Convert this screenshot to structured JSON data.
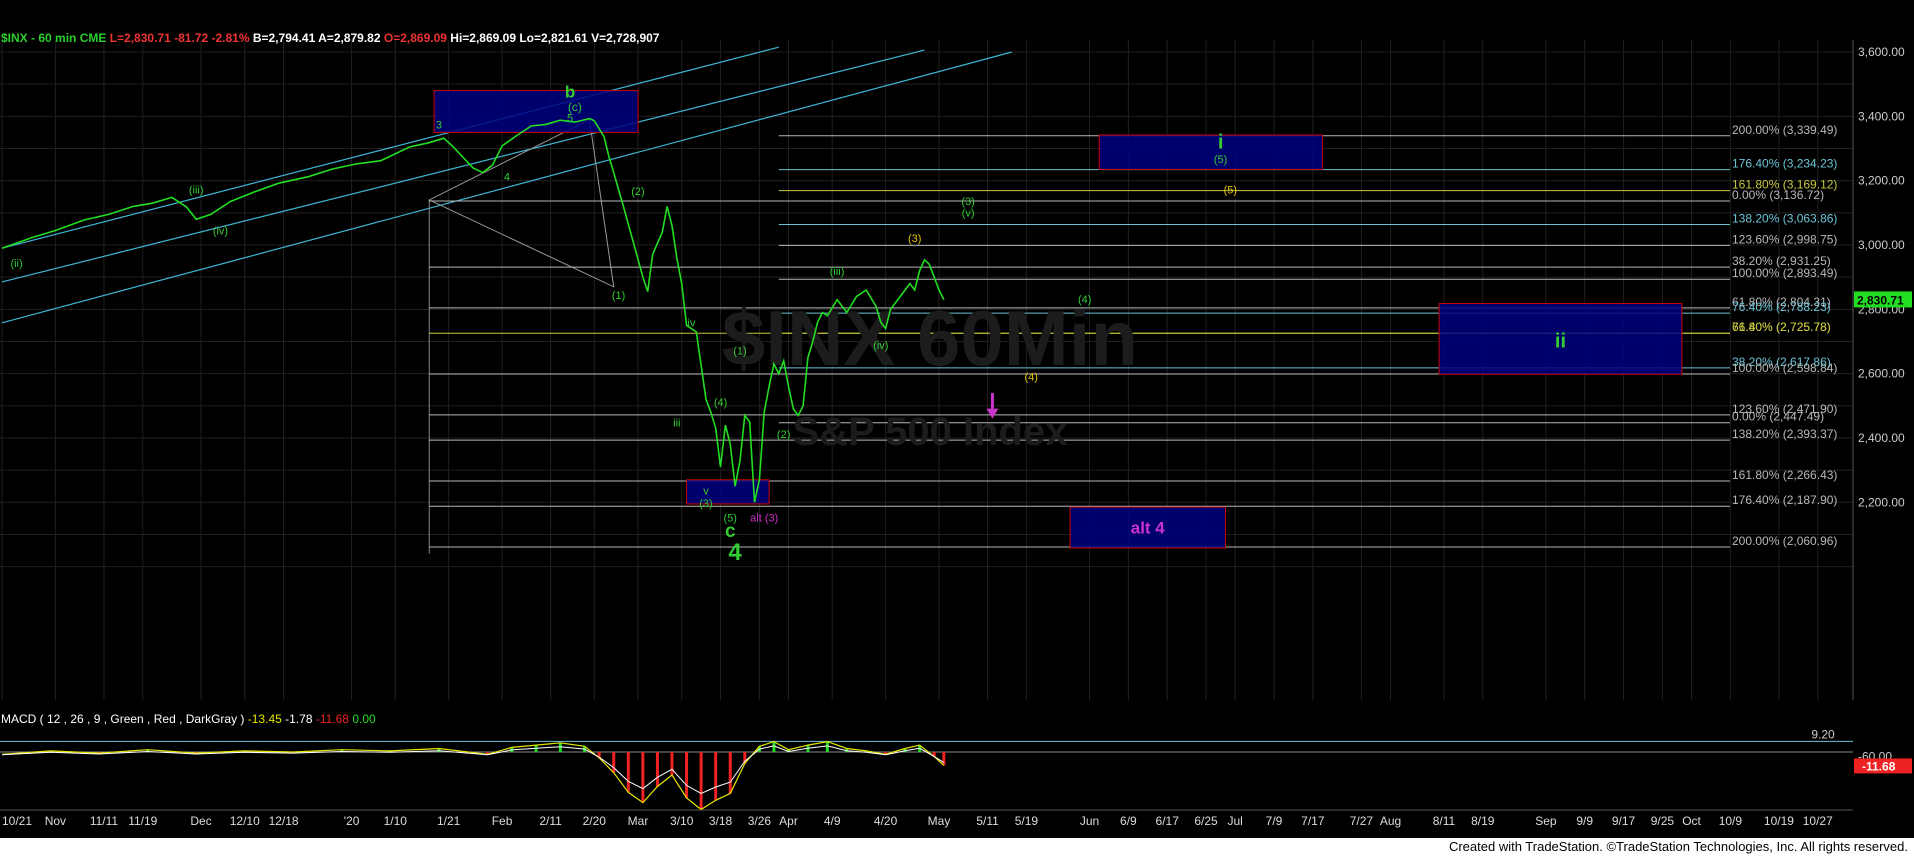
{
  "header": {
    "symbol": "$INX - 60 min CME",
    "last": "L=2,830.71",
    "change": "-81.72",
    "pct": "-2.81%",
    "bid": "B=2,794.41",
    "ask": "A=2,879.82",
    "open": "O=2,869.09",
    "high": "Hi=2,869.09",
    "low": "Lo=2,821.61",
    "volume": "V=2,728,907"
  },
  "watermark": {
    "line1": "$INX 60Min",
    "line2": "S&P 500 Index"
  },
  "macd": {
    "title": "MACD ( 12 , 26 , 9 , Green , Red , DarkGray )",
    "v1": "-13.45",
    "v2": "-1.78",
    "v3": "-11.68",
    "v4": "0.00",
    "level_label": "9.20",
    "level2": "-60.00",
    "last_badge": "-11.68"
  },
  "footer": "Created with TradeStation. ©TradeStation Technologies, Inc. All rights reserved.",
  "colors": {
    "price": "#22dd22",
    "grid": "#202020",
    "fib": "#b8b8b8",
    "fibCyan": "#6bc3d6",
    "fibYellow": "#c8c840",
    "channel": "#3fb6d6",
    "box": "#000080",
    "boxBorder": "#cc0000",
    "green": "#33cc33",
    "yellow": "#e6c200",
    "magenta": "#cc33cc",
    "macd": "#e6e600",
    "signal": "#ffffff",
    "pos": "#22dd22",
    "neg": "#ee2222"
  },
  "chart_data": {
    "type": "line",
    "title": "$INX - 60 min CME",
    "y_ticks": [
      "3,600.00",
      "3,400.00",
      "3,200.00",
      "3,000.00",
      "2,800.00",
      "2,600.00",
      "2,400.00",
      "2,200.00"
    ],
    "y_range": [
      2000,
      3620
    ],
    "last_price_label": "2,830.71",
    "x_labels": [
      {
        "t": "10/21",
        "d": 0
      },
      {
        "t": "Nov",
        "d": 11
      },
      {
        "t": "11/11",
        "d": 21
      },
      {
        "t": "11/19",
        "d": 29
      },
      {
        "t": "Dec",
        "d": 41
      },
      {
        "t": "12/10",
        "d": 50
      },
      {
        "t": "12/18",
        "d": 58
      },
      {
        "t": "'20",
        "d": 72
      },
      {
        "t": "1/10",
        "d": 81
      },
      {
        "t": "1/21",
        "d": 92
      },
      {
        "t": "Feb",
        "d": 103
      },
      {
        "t": "2/11",
        "d": 113
      },
      {
        "t": "2/20",
        "d": 122
      },
      {
        "t": "Mar",
        "d": 131
      },
      {
        "t": "3/10",
        "d": 140
      },
      {
        "t": "3/18",
        "d": 148
      },
      {
        "t": "3/26",
        "d": 156
      },
      {
        "t": "Apr",
        "d": 162
      },
      {
        "t": "4/9",
        "d": 171
      },
      {
        "t": "4/20",
        "d": 182
      },
      {
        "t": "May",
        "d": 193
      },
      {
        "t": "5/11",
        "d": 203
      },
      {
        "t": "5/19",
        "d": 211
      },
      {
        "t": "Jun",
        "d": 224
      },
      {
        "t": "6/9",
        "d": 232
      },
      {
        "t": "6/17",
        "d": 240
      },
      {
        "t": "6/25",
        "d": 248
      },
      {
        "t": "Jul",
        "d": 254
      },
      {
        "t": "7/9",
        "d": 262
      },
      {
        "t": "7/17",
        "d": 270
      },
      {
        "t": "7/27",
        "d": 280
      },
      {
        "t": "Aug",
        "d": 286
      },
      {
        "t": "8/11",
        "d": 297
      },
      {
        "t": "8/19",
        "d": 305
      },
      {
        "t": "Sep",
        "d": 318
      },
      {
        "t": "9/9",
        "d": 326
      },
      {
        "t": "9/17",
        "d": 334
      },
      {
        "t": "9/25",
        "d": 342
      },
      {
        "t": "Oct",
        "d": 348
      },
      {
        "t": "10/9",
        "d": 356
      },
      {
        "t": "10/19",
        "d": 366
      },
      {
        "t": "10/27",
        "d": 374
      }
    ],
    "price_points": [
      [
        0,
        2990
      ],
      [
        6,
        3022
      ],
      [
        11,
        3045
      ],
      [
        17,
        3078
      ],
      [
        22,
        3095
      ],
      [
        27,
        3120
      ],
      [
        31,
        3130
      ],
      [
        35,
        3148
      ],
      [
        38,
        3118
      ],
      [
        40,
        3080
      ],
      [
        43,
        3095
      ],
      [
        47,
        3135
      ],
      [
        52,
        3165
      ],
      [
        57,
        3192
      ],
      [
        63,
        3212
      ],
      [
        68,
        3236
      ],
      [
        73,
        3252
      ],
      [
        78,
        3262
      ],
      [
        84,
        3305
      ],
      [
        88,
        3318
      ],
      [
        91,
        3332
      ],
      [
        93,
        3304
      ],
      [
        95,
        3272
      ],
      [
        97,
        3240
      ],
      [
        99,
        3225
      ],
      [
        101,
        3248
      ],
      [
        103,
        3308
      ],
      [
        106,
        3340
      ],
      [
        109,
        3370
      ],
      [
        112,
        3375
      ],
      [
        115,
        3388
      ],
      [
        118,
        3382
      ],
      [
        121,
        3393
      ],
      [
        122,
        3386
      ],
      [
        124,
        3337
      ],
      [
        125,
        3275
      ],
      [
        126,
        3225
      ],
      [
        128,
        3120
      ],
      [
        130,
        3010
      ],
      [
        132,
        2900
      ],
      [
        133,
        2855
      ],
      [
        134,
        2970
      ],
      [
        136,
        3040
      ],
      [
        137,
        3120
      ],
      [
        138,
        3060
      ],
      [
        139,
        2960
      ],
      [
        140,
        2880
      ],
      [
        141,
        2750
      ],
      [
        143,
        2730
      ],
      [
        145,
        2520
      ],
      [
        146,
        2480
      ],
      [
        147,
        2430
      ],
      [
        148,
        2310
      ],
      [
        149,
        2440
      ],
      [
        150,
        2380
      ],
      [
        151,
        2250
      ],
      [
        152,
        2330
      ],
      [
        153,
        2470
      ],
      [
        154,
        2450
      ],
      [
        155,
        2200
      ],
      [
        156,
        2270
      ],
      [
        157,
        2480
      ],
      [
        158,
        2560
      ],
      [
        159,
        2630
      ],
      [
        160,
        2600
      ],
      [
        161,
        2640
      ],
      [
        162,
        2560
      ],
      [
        163,
        2490
      ],
      [
        164,
        2470
      ],
      [
        165,
        2500
      ],
      [
        166,
        2650
      ],
      [
        167,
        2700
      ],
      [
        168,
        2760
      ],
      [
        169,
        2790
      ],
      [
        170,
        2780
      ],
      [
        172,
        2830
      ],
      [
        174,
        2790
      ],
      [
        176,
        2840
      ],
      [
        178,
        2860
      ],
      [
        180,
        2810
      ],
      [
        181,
        2760
      ],
      [
        182,
        2740
      ],
      [
        183,
        2800
      ],
      [
        185,
        2840
      ],
      [
        187,
        2880
      ],
      [
        188,
        2860
      ],
      [
        189,
        2920
      ],
      [
        190,
        2954
      ],
      [
        191,
        2940
      ],
      [
        192,
        2900
      ],
      [
        193,
        2860
      ],
      [
        194,
        2830
      ]
    ],
    "channels": [
      {
        "p1": [
          0,
          2990
        ],
        "p2": [
          160,
          3615
        ]
      },
      {
        "p1": [
          0,
          2885
        ],
        "p2": [
          190,
          3606
        ]
      },
      {
        "p1": [
          0,
          2758
        ],
        "p2": [
          208,
          3600
        ]
      }
    ],
    "fib_levels": [
      {
        "label": "200.00% (3,339.49)",
        "value": 3339.49,
        "color": "fib",
        "x0": 160
      },
      {
        "label": "176.40% (3,234.23)",
        "value": 3234.23,
        "color": "fibCyan",
        "x0": 160
      },
      {
        "label": "161.80% (3,169.12)",
        "value": 3169.12,
        "color": "fibYellow",
        "x0": 160
      },
      {
        "label": "0.00% (3,136.72)",
        "value": 3136.72,
        "color": "fib",
        "x0": 88
      },
      {
        "label": "138.20% (3,063.86)",
        "value": 3063.86,
        "color": "fibCyan",
        "x0": 160
      },
      {
        "label": "123.60% (2,998.75)",
        "value": 2998.75,
        "color": "fib",
        "x0": 160
      },
      {
        "label": "38.20% (2,931.25)",
        "value": 2931.25,
        "color": "fib",
        "x0": 88
      },
      {
        "label": "100.00% (2,893.49)",
        "value": 2893.49,
        "color": "fib",
        "x0": 160
      },
      {
        "label": "61.80% (2,804.31)",
        "value": 2804.31,
        "color": "fib",
        "x0": 88
      },
      {
        "label": "76.40% (2,788.23)",
        "value": 2788.23,
        "color": "fibCyan",
        "x0": 160
      },
      {
        "label": "76.40% (2,725.78)",
        "value": 2725.78,
        "color": "fibYellow",
        "x0": 88
      },
      {
        "label": "61.80% (2,725.78)",
        "value": 2725.78,
        "color": "fibYellow",
        "x0": 160
      },
      {
        "label": "38.20% (2,617.86)",
        "value": 2617.86,
        "color": "fibCyan",
        "x0": 160
      },
      {
        "label": "100.00% (2,598.84)",
        "value": 2598.84,
        "color": "fib",
        "x0": 88
      },
      {
        "label": "123.60% (2,471.90)",
        "value": 2471.9,
        "color": "fib",
        "x0": 88
      },
      {
        "label": "0.00% (2,447.49)",
        "value": 2447.49,
        "color": "fib",
        "x0": 160
      },
      {
        "label": "138.20% (2,393.37)",
        "value": 2393.37,
        "color": "fib",
        "x0": 88
      },
      {
        "label": "161.80% (2,266.43)",
        "value": 2266.43,
        "color": "fib",
        "x0": 88
      },
      {
        "label": "176.40% (2,187.90)",
        "value": 2187.9,
        "color": "fib",
        "x0": 88
      },
      {
        "label": "200.00% (2,060.96)",
        "value": 2060.96,
        "color": "fib",
        "x0": 88
      }
    ],
    "boxes": [
      {
        "x0": 89,
        "x1": 131,
        "y0": 3350,
        "y1": 3480,
        "label": ""
      },
      {
        "x0": 226,
        "x1": 272,
        "y0": 3235,
        "y1": 3342,
        "label": ""
      },
      {
        "x0": 296,
        "x1": 346,
        "y0": 2598,
        "y1": 2818,
        "label": ""
      },
      {
        "x0": 141,
        "x1": 158,
        "y0": 2195,
        "y1": 2270,
        "label": ""
      },
      {
        "x0": 220,
        "x1": 252,
        "y0": 2058,
        "y1": 2185,
        "label": "alt 4",
        "color": "magenta",
        "size": 17
      }
    ],
    "wave_labels": [
      {
        "t": "b",
        "d": 117,
        "v": 3458,
        "c": "green",
        "s": 17
      },
      {
        "t": "(c)",
        "d": 118,
        "v": 3416,
        "c": "green",
        "s": 12
      },
      {
        "t": "5",
        "d": 117,
        "v": 3384,
        "c": "green",
        "s": 11
      },
      {
        "t": "3",
        "d": 90,
        "v": 3362,
        "c": "green",
        "s": 11
      },
      {
        "t": "4",
        "d": 104,
        "v": 3200,
        "c": "green",
        "s": 11
      },
      {
        "t": "(iii)",
        "d": 40,
        "v": 3160,
        "c": "green",
        "s": 11
      },
      {
        "t": "(iv)",
        "d": 45,
        "v": 3032,
        "c": "green",
        "s": 11
      },
      {
        "t": "(ii)",
        "d": 3,
        "v": 2932,
        "c": "green",
        "s": 11
      },
      {
        "t": "(2)",
        "d": 131,
        "v": 3155,
        "c": "green",
        "s": 11
      },
      {
        "t": "(1)",
        "d": 127,
        "v": 2832,
        "c": "green",
        "s": 11
      },
      {
        "t": "iv",
        "d": 142,
        "v": 2746,
        "c": "green",
        "s": 11
      },
      {
        "t": "iii",
        "d": 139,
        "v": 2436,
        "c": "green",
        "s": 11
      },
      {
        "t": "(4)",
        "d": 148,
        "v": 2500,
        "c": "green",
        "s": 11
      },
      {
        "t": "v",
        "d": 145,
        "v": 2224,
        "c": "green",
        "s": 11
      },
      {
        "t": "(3)",
        "d": 145,
        "v": 2186,
        "c": "green",
        "s": 11
      },
      {
        "t": "(5)",
        "d": 150,
        "v": 2140,
        "c": "green",
        "s": 11
      },
      {
        "t": "alt (3)",
        "d": 157,
        "v": 2140,
        "c": "magenta",
        "s": 11
      },
      {
        "t": "c",
        "d": 150,
        "v": 2092,
        "c": "green",
        "s": 19
      },
      {
        "t": "4",
        "d": 151,
        "v": 2020,
        "c": "green",
        "s": 24
      },
      {
        "t": "(1)",
        "d": 152,
        "v": 2660,
        "c": "green",
        "s": 11
      },
      {
        "t": "(2)",
        "d": 161,
        "v": 2400,
        "c": "green",
        "s": 11
      },
      {
        "t": "(iii)",
        "d": 172,
        "v": 2906,
        "c": "green",
        "s": 11
      },
      {
        "t": "(iv)",
        "d": 181,
        "v": 2676,
        "c": "green",
        "s": 11
      },
      {
        "t": "(3)",
        "d": 188,
        "v": 3010,
        "c": "yellow",
        "s": 11
      },
      {
        "t": "(3)",
        "d": 199,
        "v": 3124,
        "c": "green",
        "s": 11
      },
      {
        "t": "(v)",
        "d": 199,
        "v": 3088,
        "c": "green",
        "s": 11
      },
      {
        "t": "(4)",
        "d": 223,
        "v": 2820,
        "c": "green",
        "s": 11
      },
      {
        "t": "(4)",
        "d": 212,
        "v": 2578,
        "c": "yellow",
        "s": 11
      },
      {
        "t": "i",
        "d": 251,
        "v": 3300,
        "c": "green",
        "s": 20
      },
      {
        "t": "(5)",
        "d": 251,
        "v": 3255,
        "c": "green",
        "s": 11
      },
      {
        "t": "(5)",
        "d": 253,
        "v": 3160,
        "c": "yellow",
        "s": 11
      },
      {
        "t": "ii",
        "d": 321,
        "v": 2682,
        "c": "green",
        "s": 20
      }
    ],
    "triangle": [
      [
        88,
        3140
      ],
      [
        126,
        2870
      ],
      [
        121,
        3390
      ]
    ],
    "projection_line": {
      "x0": 88,
      "v0": 3140,
      "v1": 2040
    },
    "arrow": {
      "d": 204,
      "from": 2540,
      "to": 2460
    },
    "macd_hist_range": [
      -60,
      9.2
    ],
    "macd_points": [
      [
        0,
        -2
      ],
      [
        10,
        1
      ],
      [
        20,
        -1
      ],
      [
        30,
        2
      ],
      [
        40,
        -1
      ],
      [
        50,
        1
      ],
      [
        60,
        0
      ],
      [
        70,
        2
      ],
      [
        80,
        1
      ],
      [
        90,
        3
      ],
      [
        100,
        -2
      ],
      [
        105,
        4
      ],
      [
        110,
        6
      ],
      [
        115,
        8
      ],
      [
        120,
        5
      ],
      [
        123,
        -5
      ],
      [
        126,
        -18
      ],
      [
        129,
        -35
      ],
      [
        132,
        -44
      ],
      [
        135,
        -30
      ],
      [
        138,
        -20
      ],
      [
        141,
        -40
      ],
      [
        144,
        -50
      ],
      [
        147,
        -42
      ],
      [
        150,
        -36
      ],
      [
        153,
        -10
      ],
      [
        156,
        5
      ],
      [
        159,
        9
      ],
      [
        162,
        2
      ],
      [
        166,
        6
      ],
      [
        170,
        9
      ],
      [
        174,
        3
      ],
      [
        178,
        1
      ],
      [
        182,
        -2
      ],
      [
        186,
        3
      ],
      [
        189,
        6
      ],
      [
        192,
        -4
      ],
      [
        194,
        -11.68
      ]
    ]
  }
}
